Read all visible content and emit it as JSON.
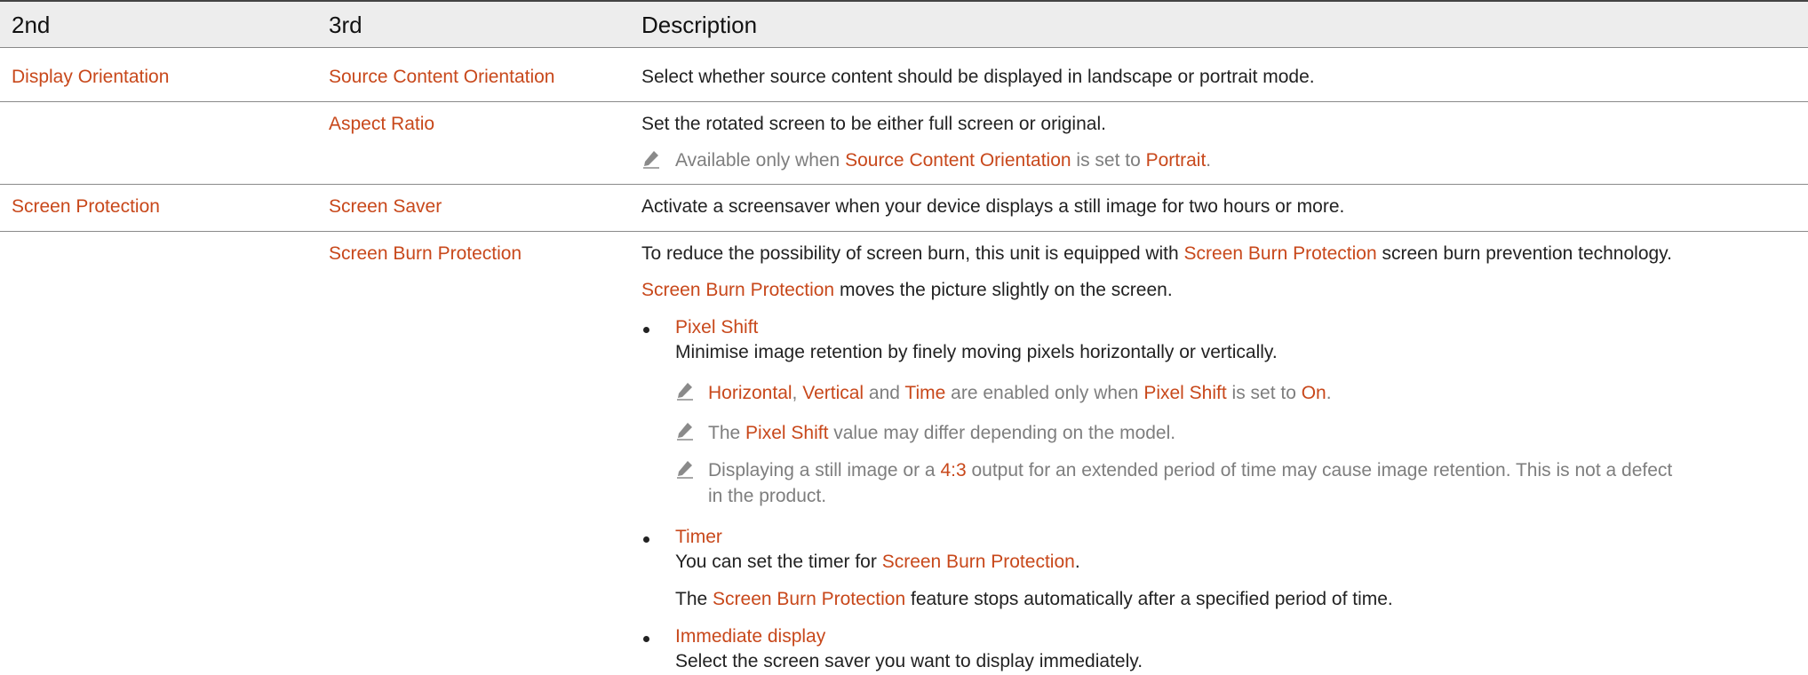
{
  "table": {
    "headers": [
      "2nd",
      "3rd",
      "Description"
    ]
  },
  "rows": {
    "display_orientation": {
      "second": "Display Orientation",
      "source_content_orientation": {
        "label": "Source Content Orientation",
        "desc": "Select whether source content should be displayed in landscape or portrait mode."
      },
      "aspect_ratio": {
        "label": "Aspect Ratio",
        "desc": "Set the rotated screen to be either full screen or original.",
        "note": {
          "p1": "Available only when ",
          "h1": "Source Content Orientation",
          "p2": " is set to ",
          "h2": "Portrait",
          "p3": "."
        }
      }
    },
    "screen_protection": {
      "second": "Screen Protection",
      "screen_saver": {
        "label": "Screen Saver",
        "desc": "Activate a screensaver when your device displays a still image for two hours or more."
      },
      "screen_burn_protection": {
        "label": "Screen Burn Protection",
        "line1": {
          "p1": "To reduce the possibility of screen burn, this unit is equipped with ",
          "h1": "Screen Burn Protection",
          "p2": " screen burn prevention technology."
        },
        "line2": {
          "h1": "Screen Burn Protection",
          "p1": " moves the picture slightly on the screen."
        },
        "pixel_shift": {
          "title": "Pixel Shift",
          "desc": "Minimise image retention by finely moving pixels horizontally or vertically.",
          "note1": {
            "h1": "Horizontal",
            "p1": ", ",
            "h2": "Vertical",
            "p2": " and ",
            "h3": "Time",
            "p3": " are enabled only when ",
            "h4": "Pixel Shift",
            "p4": " is set to ",
            "h5": "On",
            "p5": "."
          },
          "note2": {
            "p1": "The ",
            "h1": "Pixel Shift",
            "p2": " value may differ depending on the model."
          },
          "note3": {
            "p1": "Displaying a still image or a ",
            "h1": "4:3",
            "p2": " output for an extended period of time may cause image retention. This is not a defect",
            "p3": "in the product."
          }
        },
        "timer": {
          "title": "Timer",
          "line1": {
            "p1": "You can set the timer for ",
            "h1": "Screen Burn Protection",
            "p2": "."
          },
          "line2": {
            "p1": "The ",
            "h1": "Screen Burn Protection",
            "p2": " feature stops automatically after a specified period of time."
          }
        },
        "immediate_display": {
          "title": "Immediate display",
          "desc": "Select the screen saver you want to display immediately."
        }
      }
    }
  }
}
